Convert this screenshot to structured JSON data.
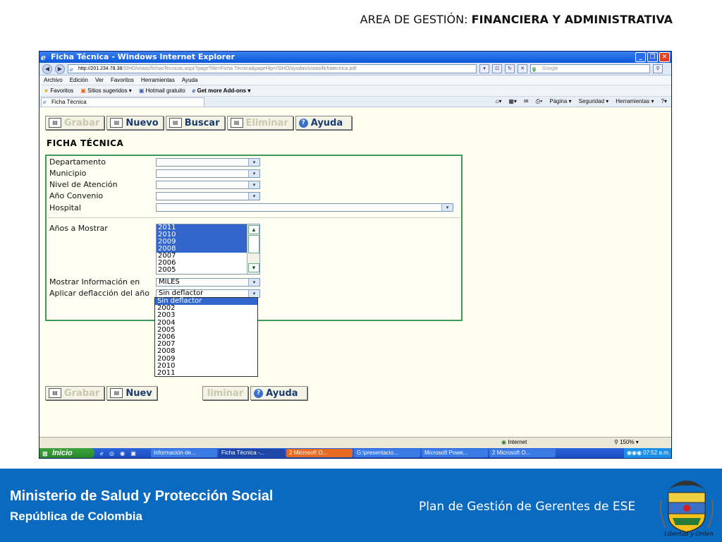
{
  "slide": {
    "header_prefix": "AREA DE GESTIÓN: ",
    "header_bold": "FINANCIERA Y ADMINISTRATIVA"
  },
  "browser": {
    "title": "Ficha Técnica - Windows Internet Explorer",
    "url_host": "http://201.234.78.38",
    "url_path": "/SIHO/vistas/fichasTecnicas.aspx?pageTitle=Ficha Técnica&pageHlp=/SIHO/ayudas/vistas/fichatecnica.pdf",
    "search_placeholder": "Google",
    "menu": [
      "Archivo",
      "Edición",
      "Ver",
      "Favoritos",
      "Herramientas",
      "Ayuda"
    ],
    "favorites": [
      "Favoritos",
      "Sitios sugeridos ▾",
      "Hotmail gratuito",
      "Get more Add-ons ▾"
    ],
    "tab_label": "Ficha Técnica",
    "tab_tools": [
      "Página ▾",
      "Seguridad ▾",
      "Herramientas ▾"
    ],
    "status_zone": "Internet",
    "zoom": "150%"
  },
  "toolbar": {
    "grabar": "Grabar",
    "nuevo": "Nuevo",
    "buscar": "Buscar",
    "eliminar": "Eliminar",
    "ayuda": "Ayuda"
  },
  "toolbar_bottom": {
    "grabar": "Grabar",
    "nuevo": "Nuev",
    "eliminar": "liminar",
    "ayuda": "Ayuda"
  },
  "form": {
    "title": "FICHA TÉCNICA",
    "departamento": "Departamento",
    "municipio": "Municipio",
    "nivel": "Nivel de Atención",
    "anio_convenio": "Año Convenio",
    "hospital": "Hospital",
    "anios_mostrar": "Años a Mostrar",
    "anios_list": [
      {
        "label": "2011",
        "selected": true
      },
      {
        "label": "2010",
        "selected": true
      },
      {
        "label": "2009",
        "selected": true
      },
      {
        "label": "2008",
        "selected": true
      },
      {
        "label": "2007",
        "selected": false
      },
      {
        "label": "2006",
        "selected": false
      },
      {
        "label": "2005",
        "selected": false
      }
    ],
    "mostrar_info": "Mostrar Información en",
    "mostrar_info_value": "MILES",
    "deflaccion": "Aplicar deflacción del año",
    "deflaccion_value": "Sin deflactor",
    "deflaccion_options": [
      "Sin deflactor",
      "2002",
      "2003",
      "2004",
      "2005",
      "2006",
      "2007",
      "2008",
      "2009",
      "2010",
      "2011"
    ]
  },
  "taskbar": {
    "start": "Inicio",
    "tasks": [
      "Información de...",
      "Ficha Técnica -...",
      "2 Microsoft O...",
      "G:\\presentacio...",
      "Microsoft Powe...",
      "2 Microsoft O..."
    ],
    "clock": "07:52 a.m."
  },
  "footer": {
    "ministry": "Ministerio de Salud y  Protección Social",
    "republic": "República de Colombia",
    "plan": "Plan de Gestión de Gerentes de ESE",
    "motto": "Libertad y Orden"
  }
}
